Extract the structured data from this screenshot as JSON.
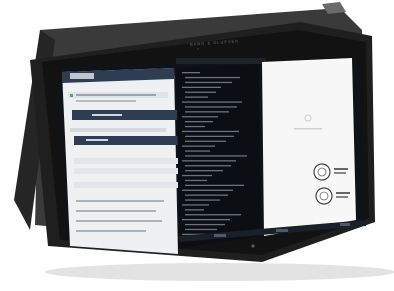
{
  "device": {
    "brand_text": "BANG & OLUFSEN"
  },
  "screen": {
    "window_title": "",
    "left_panel": {
      "app_logo": "",
      "steps": [
        "",
        "",
        "",
        "",
        "",
        ""
      ],
      "button_labels": [
        "",
        "",
        ""
      ]
    },
    "terminal_lines": 34,
    "right_panel": {
      "seal_text": ""
    },
    "taskbar": {
      "status": ""
    }
  },
  "colors": {
    "device_body": "#2a2a2a",
    "bezel": "#0d0d0d",
    "screen_dark": "#101418",
    "panel_light": "#eef0f2",
    "accent_navy": "#2e3d52",
    "accent_green": "#3cb371",
    "terminal_text": "#9aa0a6"
  }
}
